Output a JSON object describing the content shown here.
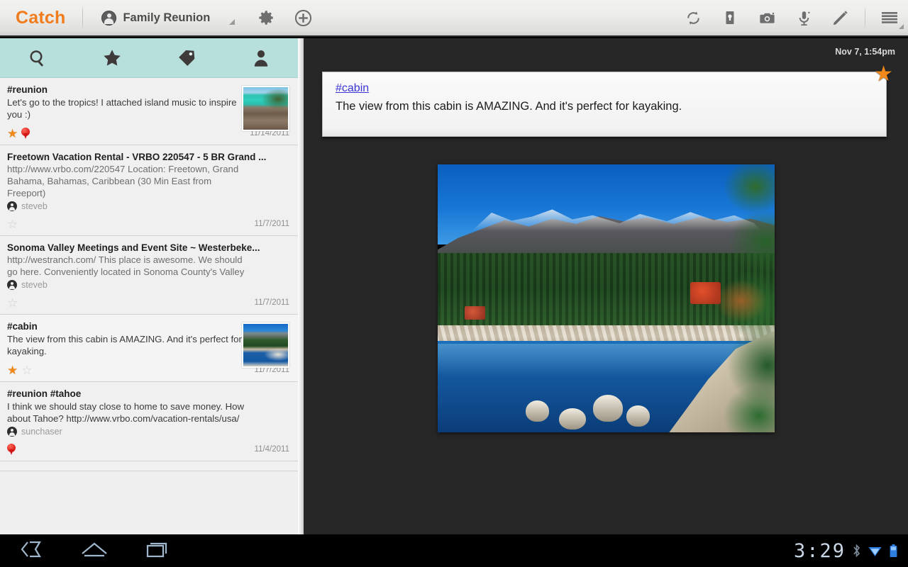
{
  "app": {
    "brand": "Catch",
    "notebook": "Family Reunion"
  },
  "actionbar": {
    "icons_left": [
      {
        "name": "settings-gear-icon",
        "label": "Settings"
      },
      {
        "name": "add-note-icon",
        "label": "Add"
      }
    ],
    "icons_right": [
      {
        "name": "sync-refresh-icon",
        "label": "Sync"
      },
      {
        "name": "note-card-icon",
        "label": "New note"
      },
      {
        "name": "camera-icon",
        "label": "Camera"
      },
      {
        "name": "microphone-icon",
        "label": "Voice note"
      },
      {
        "name": "pencil-edit-icon",
        "label": "Edit"
      },
      {
        "name": "overflow-menu-icon",
        "label": "Menu"
      }
    ]
  },
  "sidebar": {
    "tabs": [
      {
        "name": "tab-search",
        "icon": "search-icon",
        "label": "Search"
      },
      {
        "name": "tab-starred",
        "icon": "star-icon",
        "label": "Starred"
      },
      {
        "name": "tab-tags",
        "icon": "tag-icon",
        "label": "Tags"
      },
      {
        "name": "tab-people",
        "icon": "person-icon",
        "label": "People"
      }
    ],
    "notes": [
      {
        "tags": "#reunion",
        "body": "Let's go to the tropics!    I attached island music to inspire you :)",
        "author": "",
        "date": "11/14/2011",
        "starred": true,
        "has_location": true,
        "thumb": "beach",
        "selected": false
      },
      {
        "title": "Freetown Vacation Rental - VRBO 220547 - 5 BR Grand ...",
        "body": "http://www.vrbo.com/220547  Location: Freetown, Grand Bahama, Bahamas, Caribbean (30 Min East from Freeport)",
        "author": "steveb",
        "date": "11/7/2011",
        "starred": false,
        "has_location": false,
        "thumb": "",
        "selected": false
      },
      {
        "title": "Sonoma Valley Meetings and Event Site ~ Westerbeke...",
        "body": "http://westranch.com/  This place is awesome. We should go here.  Conveniently located in Sonoma County's Valley",
        "author": "steveb",
        "date": "11/7/2011",
        "starred": false,
        "has_location": false,
        "thumb": "",
        "selected": false
      },
      {
        "tags": "#cabin",
        "body": "The view from this cabin is AMAZING. And it's perfect for kayaking.",
        "author": "",
        "date": "11/7/2011",
        "starred": true,
        "has_location": false,
        "thumb": "tahoe",
        "selected": true
      },
      {
        "tags": "#reunion #tahoe",
        "body": "I think we should stay close to home to save money. How about Tahoe? http://www.vrbo.com/vacation-rentals/usa/",
        "author": "sunchaser",
        "date": "11/4/2011",
        "starred": false,
        "has_location": true,
        "thumb": "",
        "selected": false
      }
    ]
  },
  "main": {
    "date": "Nov 7, 1:54pm",
    "note": {
      "tag": "#cabin",
      "text": "The view from this cabin is AMAZING. And it's perfect for kayaking.",
      "starred": true
    },
    "photo": {
      "name": "lake-tahoe-photo",
      "alt": "Lake Tahoe shoreline with snow-capped mountains and pine trees"
    }
  },
  "systembar": {
    "nav": [
      {
        "name": "nav-back-icon",
        "label": "Back"
      },
      {
        "name": "nav-home-icon",
        "label": "Home"
      },
      {
        "name": "nav-recents-icon",
        "label": "Recent apps"
      }
    ],
    "clock": "3:29",
    "status_icons": [
      {
        "name": "bluetooth-icon",
        "label": "Bluetooth"
      },
      {
        "name": "wifi-icon",
        "label": "Wi-Fi"
      },
      {
        "name": "battery-icon",
        "label": "Battery"
      }
    ]
  },
  "colors": {
    "brand_orange": "#f07c1e",
    "tabbar_teal": "#b7e0dd",
    "star_orange": "#f0881a",
    "pin_red": "#d81a18",
    "link_blue": "#3b35d6",
    "main_background": "#272727"
  }
}
